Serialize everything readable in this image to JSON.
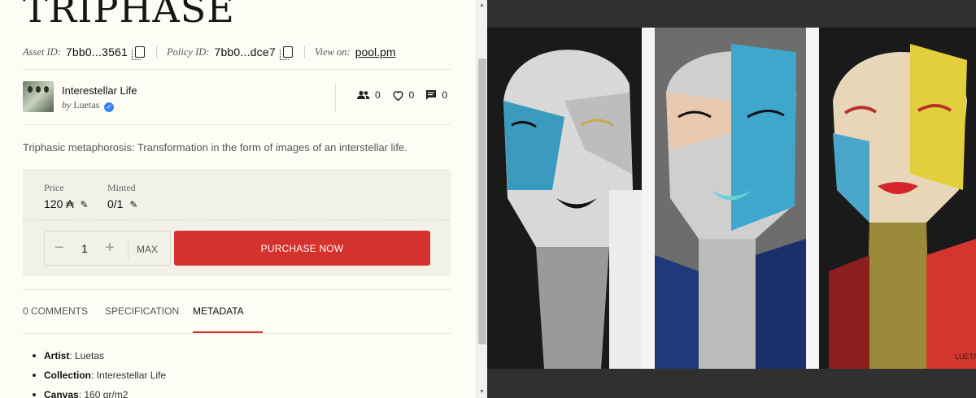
{
  "asset": {
    "title": "TRIPHASE",
    "asset_id_label": "Asset ID:",
    "asset_id": "7bb0...3561",
    "policy_id_label": "Policy ID:",
    "policy_id": "7bb0...dce7",
    "view_on_label": "View on:",
    "view_on_link": "pool.pm",
    "description": "Triphasic metaphorosis: Transformation in the form of images of an interstellar life."
  },
  "creator": {
    "collection_name": "Interestellar Life",
    "by_prefix": "by",
    "artist": "Luetas",
    "verified_icon": "verified-check-icon"
  },
  "stats": {
    "followers": "0",
    "likes": "0",
    "comments": "0"
  },
  "sale": {
    "price_label": "Price",
    "price_value": "120 ₳",
    "minted_label": "Minted",
    "minted_value": "0/1",
    "quantity": "1",
    "max_label": "MAX",
    "purchase_label": "PURCHASE NOW",
    "purchase_color": "#d5312d"
  },
  "tabs": [
    {
      "label": "0 COMMENTS"
    },
    {
      "label": "SPECIFICATION"
    },
    {
      "label": "METADATA"
    }
  ],
  "metadata": [
    {
      "key": "Artist",
      "value": ": Luetas"
    },
    {
      "key": "Collection",
      "value": ": Interestellar Life"
    },
    {
      "key": "Canvas",
      "value": ": 160 gr/m2"
    }
  ],
  "artwork": {
    "signature": "LUETAS"
  }
}
